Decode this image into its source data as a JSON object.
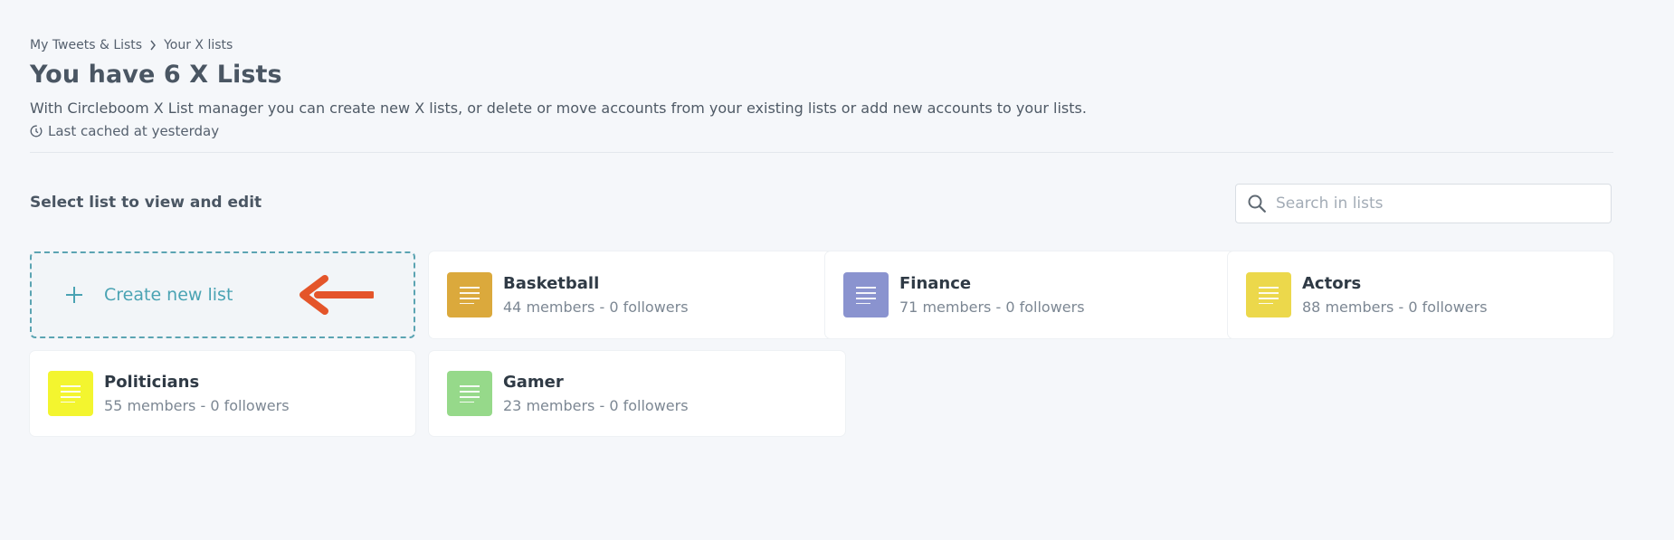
{
  "breadcrumb": {
    "items": [
      "My Tweets & Lists",
      "Your X lists"
    ]
  },
  "header": {
    "title": "You have 6 X Lists",
    "description": "With Circleboom X List manager you can create new X lists, or delete or move accounts from your existing lists or add new accounts to your lists.",
    "cached": "Last cached at yesterday"
  },
  "section": {
    "label": "Select list to view and edit"
  },
  "search": {
    "placeholder": "Search in lists"
  },
  "create": {
    "label": "Create new list"
  },
  "lists": [
    {
      "name": "Basketball",
      "meta": "44 members - 0 followers",
      "color": "#dba93c"
    },
    {
      "name": "Finance",
      "meta": "71 members - 0 followers",
      "color": "#8a93cf"
    },
    {
      "name": "Actors",
      "meta": "88 members - 0 followers",
      "color": "#ecd84b"
    },
    {
      "name": "Politicians",
      "meta": "55 members - 0 followers",
      "color": "#f3f52f"
    },
    {
      "name": "Gamer",
      "meta": "23 members - 0 followers",
      "color": "#96d98a"
    }
  ],
  "colors": {
    "accent": "#4aa3b3",
    "arrow": "#e4552a"
  }
}
